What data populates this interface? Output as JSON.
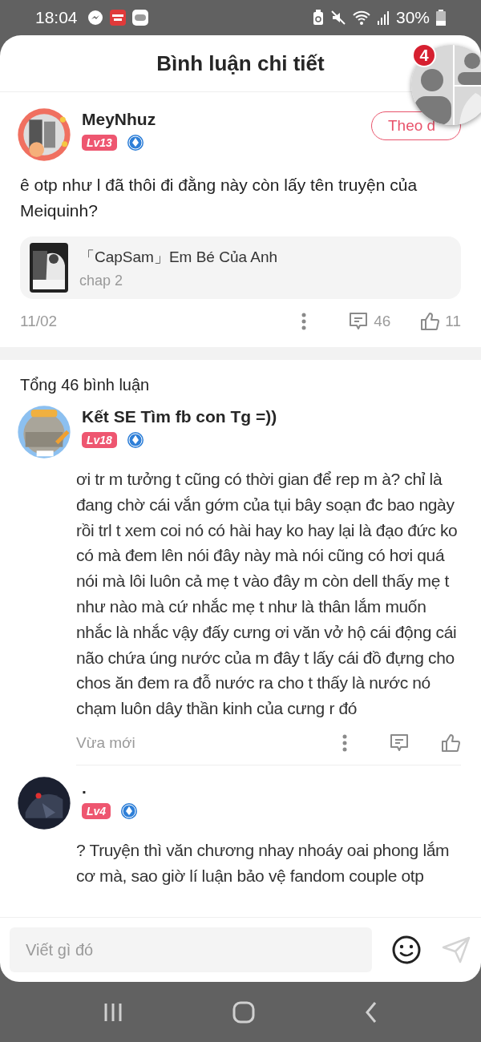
{
  "status_bar": {
    "time": "18:04",
    "battery": "30%"
  },
  "header": {
    "title": "Bình luận chi tiết"
  },
  "floating_bubble": {
    "badge": "4"
  },
  "main_comment": {
    "user": "MeyNhuz",
    "level": "Lv13",
    "follow_button": "Theo d",
    "text": "ê otp như l đã thôi đi đằng này còn lấy tên truyện của Meiquinh?",
    "story": {
      "title": "「CapSam」Em Bé Của Anh",
      "chapter": "chap 2"
    },
    "date": "11/02",
    "replies": "46",
    "likes": "11"
  },
  "total": "Tổng 46 bình luận",
  "comments": [
    {
      "user": "Kết SE Tìm fb con Tg =))",
      "level": "Lv18",
      "text": "ơi tr m tưởng t cũng có thời gian để rep m à? chỉ là đang chờ cái vắn gớm của tụi bây soạn đc bao ngày rồi trl t xem coi nó có hài hay ko hay lại là đạo đức ko có mà đem lên nói đây này mà nói cũng có hơi quá nói mà lôi luôn cả mẹ t vào đây m còn dell thấy mẹ t như nào mà cứ nhắc mẹ t như là thân lắm muốn nhắc là nhắc vậy đấy cưng ơi văn vở hộ cái động cái não chứa úng nước của m đây t lấy cái đồ đựng cho chos ăn đem ra đỗ nước ra cho t thấy là nước nó chạm luôn dây thần kinh của cưng r đó",
      "time": "Vừa mới"
    },
    {
      "user": ".",
      "level": "Lv4",
      "text": "? Truyện thì văn chương nhay nhoáy oai phong lắm cơ mà, sao giờ lí luận bảo vệ fandom couple otp"
    }
  ],
  "composer": {
    "placeholder": "Viết gì đó"
  }
}
